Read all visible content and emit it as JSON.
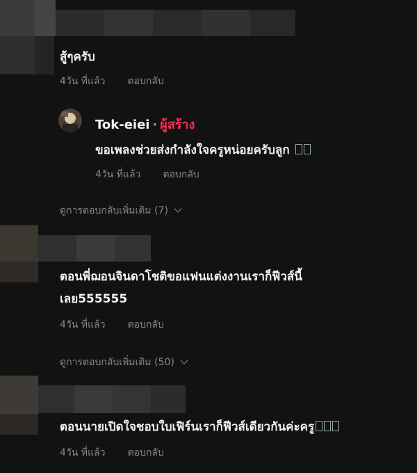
{
  "comments": [
    {
      "text": "สู้ๆครับ",
      "time": "4วัน ที่แล้ว",
      "reply_label": "ตอบกลับ",
      "reply": {
        "author": "Tok-eiei",
        "separator": "·",
        "creator_badge": "ผู้สร้าง",
        "text": "ขอเพลงช่วยส่งกำลังใจครูหน่อยครับลูก",
        "time": "4วัน ที่แล้ว",
        "reply_label": "ตอบกลับ"
      },
      "view_more": "ดูการตอบกลับเพิ่มเติม (7)"
    },
    {
      "text_line1": "ตอนพี่ฌอนจินดาโชติขอแฟนแต่งงานเราก็ฟีวส์นี้",
      "text_line2": "เลย555555",
      "time": "4วัน ที่แล้ว",
      "reply_label": "ตอบกลับ",
      "view_more": "ดูการตอบกลับเพิ่มเติม (50)"
    },
    {
      "text": "ตอนนายเปิดใจชอบใบเฟิร์นเราก็ฟีวส์เดียวกันค่ะครู",
      "time": "4วัน ที่แล้ว",
      "reply_label": "ตอบกลับ"
    }
  ],
  "icons": {
    "chevron": "chevron-down-icon",
    "emoji": "emoji-glyph"
  }
}
